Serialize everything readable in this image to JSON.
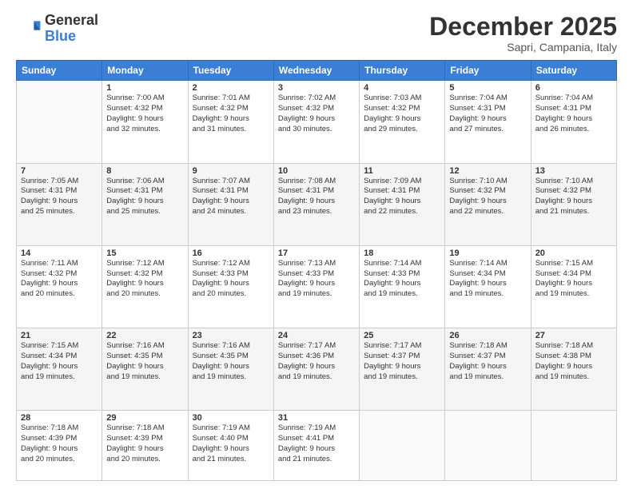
{
  "logo": {
    "general": "General",
    "blue": "Blue"
  },
  "header": {
    "month": "December 2025",
    "location": "Sapri, Campania, Italy"
  },
  "weekdays": [
    "Sunday",
    "Monday",
    "Tuesday",
    "Wednesday",
    "Thursday",
    "Friday",
    "Saturday"
  ],
  "weeks": [
    [
      {
        "day": "",
        "sunrise": "",
        "sunset": "",
        "daylight": ""
      },
      {
        "day": "1",
        "sunrise": "Sunrise: 7:00 AM",
        "sunset": "Sunset: 4:32 PM",
        "daylight": "Daylight: 9 hours and 32 minutes."
      },
      {
        "day": "2",
        "sunrise": "Sunrise: 7:01 AM",
        "sunset": "Sunset: 4:32 PM",
        "daylight": "Daylight: 9 hours and 31 minutes."
      },
      {
        "day": "3",
        "sunrise": "Sunrise: 7:02 AM",
        "sunset": "Sunset: 4:32 PM",
        "daylight": "Daylight: 9 hours and 30 minutes."
      },
      {
        "day": "4",
        "sunrise": "Sunrise: 7:03 AM",
        "sunset": "Sunset: 4:32 PM",
        "daylight": "Daylight: 9 hours and 29 minutes."
      },
      {
        "day": "5",
        "sunrise": "Sunrise: 7:04 AM",
        "sunset": "Sunset: 4:31 PM",
        "daylight": "Daylight: 9 hours and 27 minutes."
      },
      {
        "day": "6",
        "sunrise": "Sunrise: 7:04 AM",
        "sunset": "Sunset: 4:31 PM",
        "daylight": "Daylight: 9 hours and 26 minutes."
      }
    ],
    [
      {
        "day": "7",
        "sunrise": "Sunrise: 7:05 AM",
        "sunset": "Sunset: 4:31 PM",
        "daylight": "Daylight: 9 hours and 25 minutes."
      },
      {
        "day": "8",
        "sunrise": "Sunrise: 7:06 AM",
        "sunset": "Sunset: 4:31 PM",
        "daylight": "Daylight: 9 hours and 25 minutes."
      },
      {
        "day": "9",
        "sunrise": "Sunrise: 7:07 AM",
        "sunset": "Sunset: 4:31 PM",
        "daylight": "Daylight: 9 hours and 24 minutes."
      },
      {
        "day": "10",
        "sunrise": "Sunrise: 7:08 AM",
        "sunset": "Sunset: 4:31 PM",
        "daylight": "Daylight: 9 hours and 23 minutes."
      },
      {
        "day": "11",
        "sunrise": "Sunrise: 7:09 AM",
        "sunset": "Sunset: 4:31 PM",
        "daylight": "Daylight: 9 hours and 22 minutes."
      },
      {
        "day": "12",
        "sunrise": "Sunrise: 7:10 AM",
        "sunset": "Sunset: 4:32 PM",
        "daylight": "Daylight: 9 hours and 22 minutes."
      },
      {
        "day": "13",
        "sunrise": "Sunrise: 7:10 AM",
        "sunset": "Sunset: 4:32 PM",
        "daylight": "Daylight: 9 hours and 21 minutes."
      }
    ],
    [
      {
        "day": "14",
        "sunrise": "Sunrise: 7:11 AM",
        "sunset": "Sunset: 4:32 PM",
        "daylight": "Daylight: 9 hours and 20 minutes."
      },
      {
        "day": "15",
        "sunrise": "Sunrise: 7:12 AM",
        "sunset": "Sunset: 4:32 PM",
        "daylight": "Daylight: 9 hours and 20 minutes."
      },
      {
        "day": "16",
        "sunrise": "Sunrise: 7:12 AM",
        "sunset": "Sunset: 4:33 PM",
        "daylight": "Daylight: 9 hours and 20 minutes."
      },
      {
        "day": "17",
        "sunrise": "Sunrise: 7:13 AM",
        "sunset": "Sunset: 4:33 PM",
        "daylight": "Daylight: 9 hours and 19 minutes."
      },
      {
        "day": "18",
        "sunrise": "Sunrise: 7:14 AM",
        "sunset": "Sunset: 4:33 PM",
        "daylight": "Daylight: 9 hours and 19 minutes."
      },
      {
        "day": "19",
        "sunrise": "Sunrise: 7:14 AM",
        "sunset": "Sunset: 4:34 PM",
        "daylight": "Daylight: 9 hours and 19 minutes."
      },
      {
        "day": "20",
        "sunrise": "Sunrise: 7:15 AM",
        "sunset": "Sunset: 4:34 PM",
        "daylight": "Daylight: 9 hours and 19 minutes."
      }
    ],
    [
      {
        "day": "21",
        "sunrise": "Sunrise: 7:15 AM",
        "sunset": "Sunset: 4:34 PM",
        "daylight": "Daylight: 9 hours and 19 minutes."
      },
      {
        "day": "22",
        "sunrise": "Sunrise: 7:16 AM",
        "sunset": "Sunset: 4:35 PM",
        "daylight": "Daylight: 9 hours and 19 minutes."
      },
      {
        "day": "23",
        "sunrise": "Sunrise: 7:16 AM",
        "sunset": "Sunset: 4:35 PM",
        "daylight": "Daylight: 9 hours and 19 minutes."
      },
      {
        "day": "24",
        "sunrise": "Sunrise: 7:17 AM",
        "sunset": "Sunset: 4:36 PM",
        "daylight": "Daylight: 9 hours and 19 minutes."
      },
      {
        "day": "25",
        "sunrise": "Sunrise: 7:17 AM",
        "sunset": "Sunset: 4:37 PM",
        "daylight": "Daylight: 9 hours and 19 minutes."
      },
      {
        "day": "26",
        "sunrise": "Sunrise: 7:18 AM",
        "sunset": "Sunset: 4:37 PM",
        "daylight": "Daylight: 9 hours and 19 minutes."
      },
      {
        "day": "27",
        "sunrise": "Sunrise: 7:18 AM",
        "sunset": "Sunset: 4:38 PM",
        "daylight": "Daylight: 9 hours and 19 minutes."
      }
    ],
    [
      {
        "day": "28",
        "sunrise": "Sunrise: 7:18 AM",
        "sunset": "Sunset: 4:39 PM",
        "daylight": "Daylight: 9 hours and 20 minutes."
      },
      {
        "day": "29",
        "sunrise": "Sunrise: 7:18 AM",
        "sunset": "Sunset: 4:39 PM",
        "daylight": "Daylight: 9 hours and 20 minutes."
      },
      {
        "day": "30",
        "sunrise": "Sunrise: 7:19 AM",
        "sunset": "Sunset: 4:40 PM",
        "daylight": "Daylight: 9 hours and 21 minutes."
      },
      {
        "day": "31",
        "sunrise": "Sunrise: 7:19 AM",
        "sunset": "Sunset: 4:41 PM",
        "daylight": "Daylight: 9 hours and 21 minutes."
      },
      {
        "day": "",
        "sunrise": "",
        "sunset": "",
        "daylight": ""
      },
      {
        "day": "",
        "sunrise": "",
        "sunset": "",
        "daylight": ""
      },
      {
        "day": "",
        "sunrise": "",
        "sunset": "",
        "daylight": ""
      }
    ]
  ]
}
